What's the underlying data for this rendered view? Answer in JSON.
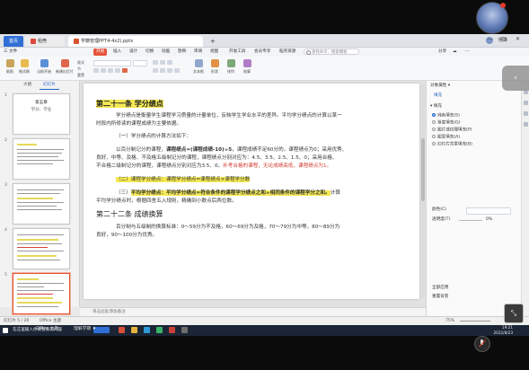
{
  "window": {
    "tabs": [
      {
        "label": "首页"
      },
      {
        "label": "稻壳"
      },
      {
        "label": "学籍管理PPT4-4x2).pptx"
      },
      {
        "label": "+"
      }
    ],
    "user_name": "杨锋",
    "window_controls": "— ▢ ✕"
  },
  "menu": {
    "items": [
      "三 文件",
      "开始",
      "插入",
      "设计",
      "切换",
      "动画",
      "放映",
      "审阅",
      "视图",
      "开发工具",
      "会员专享",
      "稻壳资源"
    ],
    "active_index": 1,
    "search_placeholder": "查找命令、搜索模板",
    "right_items": [
      "分享",
      "☁",
      "⋯"
    ]
  },
  "ribbon": {
    "buttons": [
      "粘贴",
      "格式刷",
      "当前开始",
      "新建幻灯片",
      "版式",
      "节",
      "重置"
    ],
    "buttons_right": [
      "文本框",
      "形状",
      "排列",
      "轮廓"
    ]
  },
  "sidepane": {
    "tabs": [
      "大纲",
      "幻灯片"
    ],
    "active_tab": 1,
    "slides": [
      {
        "num": "1",
        "title": "第五章",
        "subtitle": "学分、学业"
      },
      {
        "num": "2",
        "title": ""
      },
      {
        "num": "3",
        "title": ""
      },
      {
        "num": "4",
        "title": ""
      },
      {
        "num": "5",
        "title": ""
      }
    ],
    "selected_slide": 5
  },
  "slide": {
    "heading1": "第二十一条  学分绩点",
    "para1_l1": "学分绩点是衡量学生课程学习质量的计量单位，反映学生学业水平的差异。平均学分绩点的计算以某一",
    "para1_l2": "时段内所修读的课程成绩为主要依据。",
    "sub1": "（一）学分绩点的计算方法如下：",
    "para2_a": "以百分制记分的课程，",
    "para2_formula": "课程绩点=(课程成绩-10)÷5",
    "para2_b": "，课程成绩不足60分的，课程绩点为0；采用优秀、",
    "para2_l2": "良好、中等、及格、不及格五级制记分的课程，课程绩点分别对应为：4.5、3.5、2.5、1.5、0；采用合格、",
    "para2_l3a": "不合格二级制记分的课程，课程绩点分别对应为3.5、0。",
    "para2_l3red": "补考合格的课程，无论成绩高低，课程绩点为1。",
    "sub2": "（二）课程学分绩点：课程学分绩点=课程绩点×课程学分数",
    "sub3_a": "（三）",
    "sub3_hl": "平均学分绩点：平均学分绩点=符合条件的课程学分绩点之和÷相同条件的课程学分之和。",
    "sub3_b": "计算",
    "sub3_l2": "平均学分绩点时，根据四舍五入规则，精确到小数点后两位数。",
    "heading2": "第二十二条  成绩换算",
    "para3_l1": "百分制与五级制的换算标准：0～59分为不及格，60～69分为及格，70～79分为中等，80～89分为",
    "para3_l2": "良好，90～100分为优秀。"
  },
  "notes_placeholder": "单击此处添加备注",
  "rightpanel": {
    "title": "对象属性 ▾",
    "tab": "填充",
    "section": "▾ 填充",
    "options": [
      "纯色填充(S)",
      "渐变填充(G)",
      "图片或纹理填充(P)",
      "图案填充(A)",
      "幻灯片背景填充(B)"
    ],
    "selected_option": 0,
    "row_color_label": "颜色(C)",
    "row_transparency_label": "透明度(T)",
    "transparency_value": "0%",
    "apply_all": "全部应用",
    "reset_bg": "重置背景"
  },
  "statusbar": {
    "slide_info": "幻灯片 5 / 20",
    "theme": "Office 主题",
    "zoom": "75%"
  },
  "taskbar": {
    "search": "在这里输入你要搜索的内容",
    "app_label": "Office 主题",
    "pinned": "理解学期 ♦",
    "time": "19:21",
    "date": "2022/8/23"
  },
  "overlay": {
    "float_cta_glyph": "‹",
    "float_btn_glyph": "⤡"
  },
  "colors": {
    "accent": "#e6533b",
    "highlight": "#f6ea55",
    "red_text": "#d13b2f",
    "link_blue": "#1d63c6"
  }
}
